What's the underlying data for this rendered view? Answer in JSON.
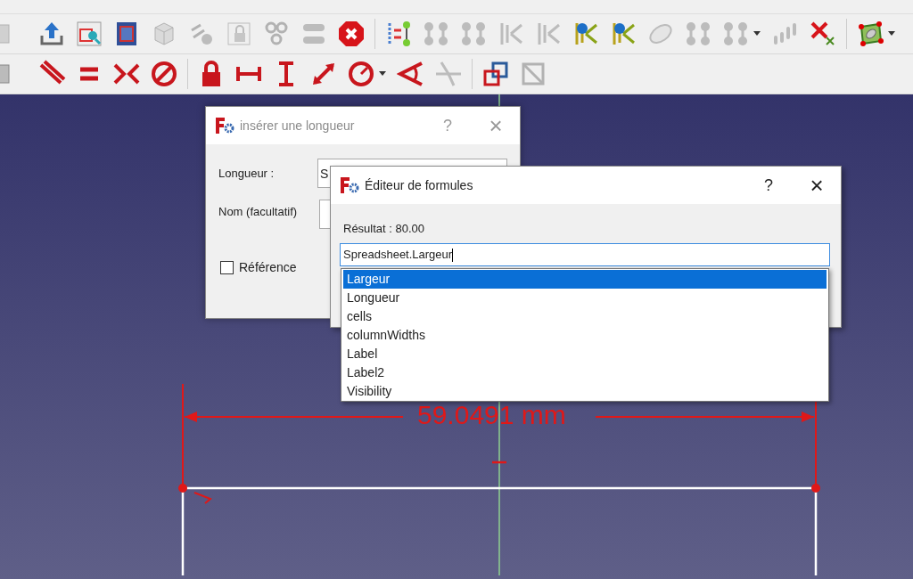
{
  "toolbar_rows": [
    {
      "groups": [
        {
          "items": [
            {
              "kind": "partial",
              "disabled": true
            },
            {
              "kind": "upload",
              "disabled": false
            },
            {
              "kind": "inspect",
              "disabled": false
            },
            {
              "kind": "view",
              "disabled": false
            },
            {
              "kind": "cube",
              "disabled": true
            },
            {
              "kind": "tool",
              "disabled": true
            },
            {
              "kind": "lockbox",
              "disabled": true
            },
            {
              "kind": "chain",
              "disabled": true
            },
            {
              "kind": "nodes",
              "disabled": true
            },
            {
              "kind": "stop",
              "disabled": false
            }
          ]
        },
        {
          "items": [
            {
              "kind": "dof",
              "disabled": false
            },
            {
              "kind": "links",
              "disabled": true
            },
            {
              "kind": "links",
              "disabled": true
            },
            {
              "kind": "hatch",
              "disabled": true
            },
            {
              "kind": "hatch",
              "disabled": true
            },
            {
              "kind": "warn",
              "disabled": false
            },
            {
              "kind": "warn",
              "disabled": false
            },
            {
              "kind": "ellipse",
              "disabled": true
            },
            {
              "kind": "links",
              "disabled": true
            },
            {
              "kind": "links",
              "disabled": true
            },
            {
              "kind": "dropdown",
              "disabled": false
            },
            {
              "kind": "dots",
              "disabled": true
            },
            {
              "kind": "xred",
              "disabled": false
            }
          ]
        },
        {
          "items": [
            {
              "kind": "quad",
              "disabled": false
            },
            {
              "kind": "dropdown",
              "disabled": false
            }
          ]
        }
      ]
    },
    {
      "groups": [
        {
          "items": [
            {
              "kind": "partial",
              "disabled": false
            },
            {
              "kind": "parallel",
              "disabled": false
            },
            {
              "kind": "equal",
              "disabled": false
            },
            {
              "kind": "symmetric",
              "disabled": false
            },
            {
              "kind": "block",
              "disabled": false
            }
          ]
        },
        {
          "items": [
            {
              "kind": "lock",
              "disabled": false
            },
            {
              "kind": "hdist",
              "disabled": false
            },
            {
              "kind": "vdist",
              "disabled": false
            },
            {
              "kind": "diag",
              "disabled": false
            },
            {
              "kind": "radius",
              "disabled": false
            },
            {
              "kind": "dropdown",
              "disabled": false
            },
            {
              "kind": "angle",
              "disabled": false
            },
            {
              "kind": "snell",
              "disabled": true
            }
          ]
        },
        {
          "items": [
            {
              "kind": "construction",
              "disabled": false
            },
            {
              "kind": "toggle",
              "disabled": true
            }
          ]
        }
      ]
    }
  ],
  "sketch": {
    "dimension": "59.0491 mm"
  },
  "length_dialog": {
    "title": "insérer une longueur",
    "help": "?",
    "close": "×",
    "length_label": "Longueur :",
    "length_value": "S",
    "name_label": "Nom (facultatif)",
    "reference": {
      "label": "Référence",
      "checked": false
    }
  },
  "formula_dialog": {
    "title": "Éditeur de formules",
    "help": "?",
    "close": "×",
    "result": "Résultat : 80.00",
    "value": "Spreadsheet.Largeur",
    "suggestions": [
      {
        "label": "Largeur",
        "selected": true
      },
      {
        "label": "Longueur",
        "selected": false
      },
      {
        "label": "cells",
        "selected": false
      },
      {
        "label": "columnWidths",
        "selected": false
      },
      {
        "label": "Label",
        "selected": false
      },
      {
        "label": "Label2",
        "selected": false
      },
      {
        "label": "Visibility",
        "selected": false
      }
    ]
  }
}
